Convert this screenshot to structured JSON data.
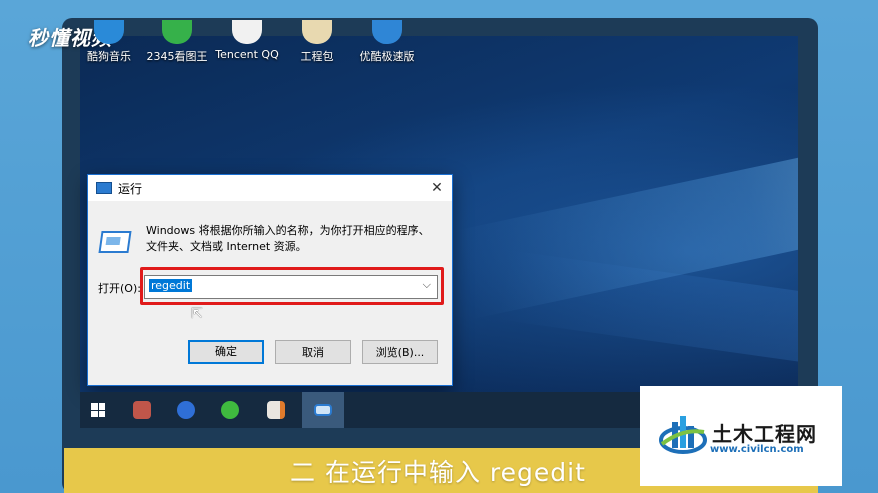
{
  "brand": {
    "text": "秒懂视频"
  },
  "desktop_icons": [
    {
      "label": "酷狗音乐",
      "icon": "kugou-music-icon",
      "color": "#2a8ad8"
    },
    {
      "label": "2345看图王",
      "icon": "image-viewer-icon",
      "color": "#36b14a"
    },
    {
      "label": "Tencent QQ",
      "icon": "qq-penguin-icon",
      "color": "#f1f1f1"
    },
    {
      "label": "工程包",
      "icon": "folder-icon",
      "color": "#e8d9b0"
    },
    {
      "label": "优酷极速版",
      "icon": "youku-exp-icon",
      "color": "#2f86d6"
    }
  ],
  "run_dialog": {
    "title": "运行",
    "close": "✕",
    "description_line1": "Windows 将根据你所输入的名称，为你打开相应的程序、",
    "description_line2": "文件夹、文档或 Internet 资源。",
    "open_label": "打开(O):",
    "open_value": "regedit",
    "ok_label": "确定",
    "cancel_label": "取消",
    "browse_label": "浏览(B)..."
  },
  "taskbar": {
    "items": [
      "start-icon",
      "app-avatar-icon",
      "wps-icon",
      "wechat-icon",
      "presentation-icon",
      "run-icon"
    ]
  },
  "caption": {
    "text": "二 在运行中输入 regedit"
  },
  "watermark": {
    "title": "土木工程网",
    "url": "www.civilcn.com"
  }
}
